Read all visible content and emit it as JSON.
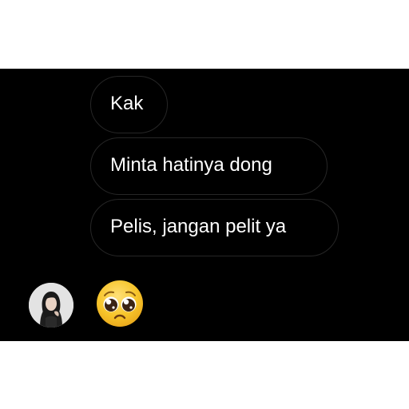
{
  "conversation": {
    "messages": [
      {
        "text": "Kak"
      },
      {
        "text": "Minta hatinya dong"
      },
      {
        "text": "Pelis, jangan pelit ya"
      }
    ],
    "reaction_emoji": "pleading-face-icon",
    "sender_avatar": "profile-photo"
  },
  "colors": {
    "panel_background": "#000000",
    "page_background": "#ffffff",
    "bubble_border": "#262626",
    "message_text": "#ffffff",
    "emoji_face": "#f7c52b"
  }
}
